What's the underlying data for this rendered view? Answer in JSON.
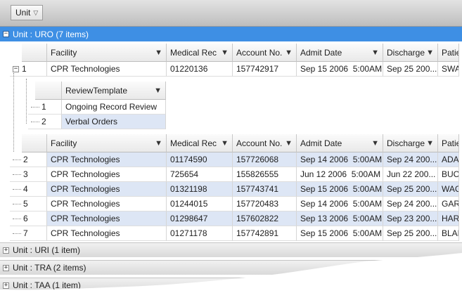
{
  "group_panel": {
    "chip_label": "Unit",
    "chip_filter_icon": "funnel-outline-icon"
  },
  "groups": [
    {
      "label": "Unit : URO (7 items)",
      "expander": "−"
    },
    {
      "label": "Unit : URI (1 item)",
      "expander": "+"
    },
    {
      "label": "Unit : TRA (2 items)",
      "expander": "+"
    },
    {
      "label": "Unit : TAA (1 item)",
      "expander": "+"
    }
  ],
  "columns": [
    "Facility",
    "Medical Rec",
    "Account No.",
    "Admit Date",
    "Discharge",
    "Patie"
  ],
  "first_row": {
    "num": "1",
    "expander": "−",
    "facility": "CPR Technologies",
    "medical_rec": "01220136",
    "account": "157742917",
    "admit": "Sep 15 2006  5:00AM",
    "discharge": "Sep 25 200...",
    "patient": "SWA"
  },
  "detail": {
    "column": "ReviewTemplate",
    "rows": [
      {
        "num": "1",
        "value": "Ongoing Record Review"
      },
      {
        "num": "2",
        "value": "Verbal Orders"
      }
    ]
  },
  "rows": [
    {
      "num": "2",
      "facility": "CPR Technologies",
      "medical_rec": "01174590",
      "account": "157726068",
      "admit": "Sep 14 2006  5:00AM",
      "discharge": "Sep 24 200...",
      "patient": "ADAI"
    },
    {
      "num": "3",
      "facility": "CPR Technologies",
      "medical_rec": "725654",
      "account": "155826555",
      "admit": "Jun 12 2006  5:00AM",
      "discharge": "Jun 22 200...",
      "patient": "BUCK"
    },
    {
      "num": "4",
      "facility": "CPR Technologies",
      "medical_rec": "01321198",
      "account": "157743741",
      "admit": "Sep 15 2006  5:00AM",
      "discharge": "Sep 25 200...",
      "patient": "WAG"
    },
    {
      "num": "5",
      "facility": "CPR Technologies",
      "medical_rec": "01244015",
      "account": "157720483",
      "admit": "Sep 14 2006  5:00AM",
      "discharge": "Sep 24 200...",
      "patient": "GARI"
    },
    {
      "num": "6",
      "facility": "CPR Technologies",
      "medical_rec": "01298647",
      "account": "157602822",
      "admit": "Sep 13 2006  5:00AM",
      "discharge": "Sep 23 200...",
      "patient": "HARI"
    },
    {
      "num": "7",
      "facility": "CPR Technologies",
      "medical_rec": "01271178",
      "account": "157742891",
      "admit": "Sep 15 2006  5:00AM",
      "discharge": "Sep 25 200...",
      "patient": "BLAK"
    }
  ],
  "colors": {
    "group_active": "#3e8fe4",
    "row_alt": "#dde6f5"
  }
}
